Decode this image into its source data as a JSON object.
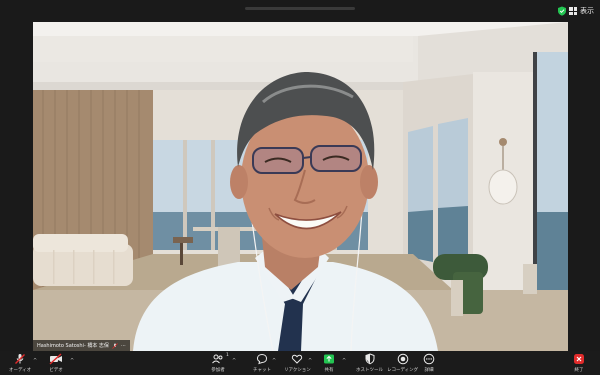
{
  "window": {
    "view_label": "表示",
    "shield_color": "#23c552"
  },
  "participant": {
    "name": "Hashimoto Satoshi- 橋本 志保"
  },
  "toolbar": {
    "audio_label": "オーディオ",
    "video_label": "ビデオ",
    "participants_label": "参加者",
    "participants_count": "1",
    "chat_label": "チャット",
    "reactions_label": "リアクション",
    "share_label": "共有",
    "hostTools_label": "ホストツール",
    "record_label": "レコーディング",
    "more_label": "詳細",
    "end_label": "終了"
  },
  "colors": {
    "accent_red": "#e02b2b",
    "share_green": "#23c552"
  }
}
